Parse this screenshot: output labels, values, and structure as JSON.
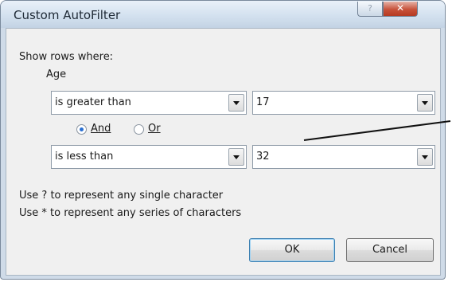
{
  "window": {
    "title": "Custom AutoFilter"
  },
  "dialog": {
    "show_rows_label": "Show rows where:",
    "field_name": "Age",
    "condition1": {
      "operator": "is greater than",
      "value": "17"
    },
    "logic": {
      "and_label": "And",
      "or_label": "Or",
      "selected": "And"
    },
    "condition2": {
      "operator": "is less than",
      "value": "32"
    },
    "hint1": "Use ? to represent any single character",
    "hint2": "Use * to represent any series of characters",
    "ok_label": "OK",
    "cancel_label": "Cancel"
  },
  "icons": {
    "help": "help-icon",
    "close": "close-icon",
    "dropdown": "chevron-down-icon"
  }
}
